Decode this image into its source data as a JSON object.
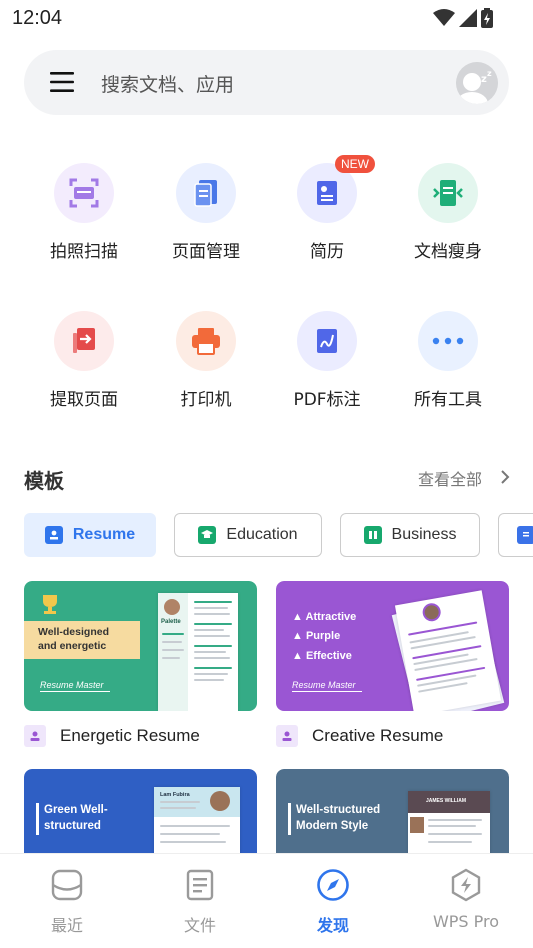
{
  "status_bar": {
    "time": "12:04"
  },
  "search": {
    "placeholder": "搜索文档、应用"
  },
  "tools": [
    {
      "label": "拍照扫描",
      "icon": "camera-scan-icon"
    },
    {
      "label": "页面管理",
      "icon": "page-manage-icon"
    },
    {
      "label": "简历",
      "icon": "resume-icon",
      "badge": "NEW"
    },
    {
      "label": "文档瘦身",
      "icon": "doc-slim-icon"
    },
    {
      "label": "提取页面",
      "icon": "extract-page-icon"
    },
    {
      "label": "打印机",
      "icon": "printer-icon"
    },
    {
      "label": "PDF标注",
      "icon": "pdf-annotate-icon"
    },
    {
      "label": "所有工具",
      "icon": "more-icon"
    }
  ],
  "templates": {
    "title": "模板",
    "view_all": "查看全部",
    "categories": [
      {
        "label": "Resume",
        "active": true
      },
      {
        "label": "Education",
        "active": false
      },
      {
        "label": "Business",
        "active": false
      }
    ],
    "cards": [
      {
        "title": "Energetic Resume",
        "banner": "Well-designed and energetic",
        "brand": "Resume Master",
        "name": "Palette",
        "color": "#35ab86"
      },
      {
        "title": "Creative Resume",
        "features": [
          "Attractive",
          "Purple",
          "Effective"
        ],
        "brand": "Resume Master",
        "color": "#9a56d3"
      },
      {
        "banner": "Green Well-structured",
        "name": "Lam Fubira",
        "color": "#2f5fc4"
      },
      {
        "banner": "Well-structured Modern Style",
        "name": "JAMES WILLIAM",
        "color": "#4f6f8c"
      }
    ]
  },
  "bottom_nav": [
    {
      "label": "最近",
      "active": false
    },
    {
      "label": "文件",
      "active": false
    },
    {
      "label": "发现",
      "active": true
    },
    {
      "label": "WPS Pro",
      "active": false
    }
  ],
  "colors": {
    "accent": "#2f75ec",
    "badge": "#f0513d"
  }
}
